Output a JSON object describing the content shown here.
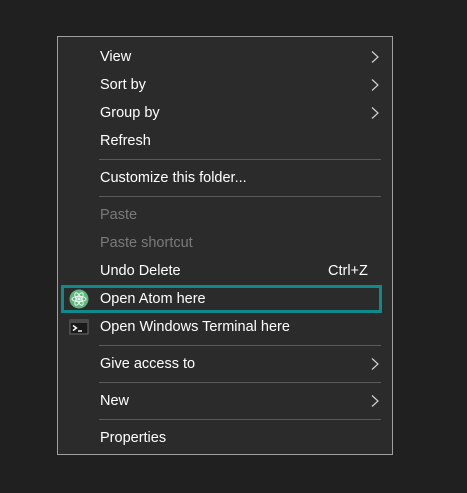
{
  "context_menu": {
    "items": [
      {
        "label": "View",
        "submenu": true
      },
      {
        "label": "Sort by",
        "submenu": true
      },
      {
        "label": "Group by",
        "submenu": true
      },
      {
        "label": "Refresh"
      },
      {
        "label": "Customize this folder..."
      },
      {
        "label": "Paste",
        "disabled": true
      },
      {
        "label": "Paste shortcut",
        "disabled": true
      },
      {
        "label": "Undo Delete",
        "shortcut": "Ctrl+Z"
      },
      {
        "label": "Open Atom here",
        "icon": "atom-icon",
        "highlighted": true
      },
      {
        "label": "Open Windows Terminal here",
        "icon": "terminal-icon"
      },
      {
        "label": "Give access to",
        "submenu": true
      },
      {
        "label": "New",
        "submenu": true
      },
      {
        "label": "Properties"
      }
    ]
  },
  "colors": {
    "background": "#202020",
    "menu_background": "#2b2b2b",
    "highlight_outline": "#0f8a8a",
    "disabled_text": "#7a7a7a"
  }
}
